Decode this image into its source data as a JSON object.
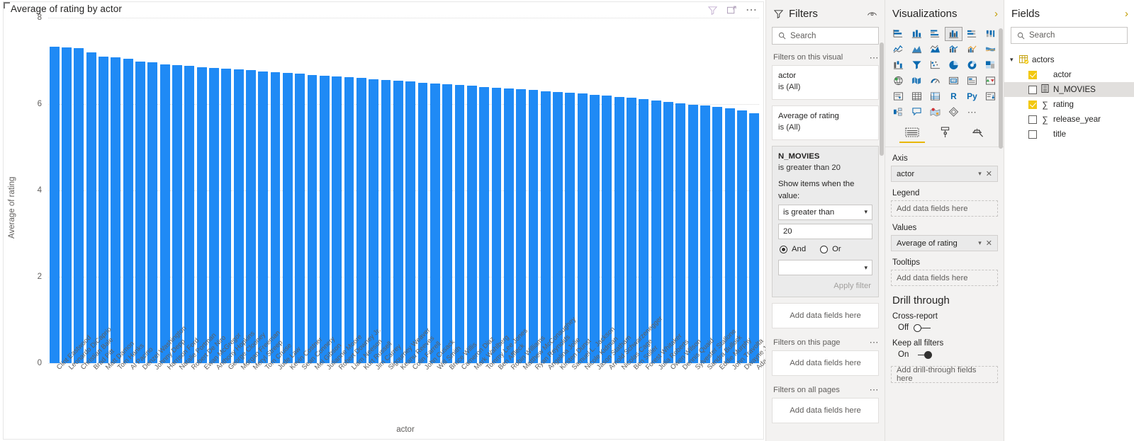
{
  "visual": {
    "title": "Average of rating by actor",
    "x_axis_title": "actor",
    "y_axis_title": "Average of rating",
    "header_icons": [
      "filter-icon",
      "focus-mode-icon",
      "more-options-icon"
    ]
  },
  "chart_data": {
    "type": "bar",
    "title": "Average of rating by actor",
    "xlabel": "actor",
    "ylabel": "Average of rating",
    "ylim": [
      0,
      8
    ],
    "yticks": [
      0,
      2,
      4,
      6,
      8
    ],
    "grid": true,
    "legend": "none",
    "bar_color": "#1f8af5",
    "categories": [
      "Clint Eastwood",
      "Leonardo DiCaprio",
      "Christian Bale",
      "Brad Pitt",
      "Matt Damon",
      "Tom Hanks",
      "Al Pacino",
      "Denzel Washington",
      "Johnny Depp",
      "Harrison Ford",
      "Natalie Portman",
      "Robert De Niro",
      "Ewan McGregor",
      "Anthony Hopkins",
      "George Clooney",
      "Morgan Freeman",
      "Meryl Streep",
      "Tom Cruise",
      "Jude Law",
      "Kevin Costner",
      "Sean Connery",
      "Mel Gibson",
      "Julianne Moore",
      "Robert Downey Jr.",
      "Liam Neeson",
      "Kurt Russell",
      "Jim Carrey",
      "Sigourney Weaver",
      "Keanu Reeves",
      "Colin Farrell",
      "John Cusack",
      "Will Smith",
      "Bruce Willis",
      "Cameron Diaz",
      "Mark Wahlberg",
      "Tommy Lee Jones",
      "Ben Affleck",
      "Robin Williams",
      "Matthew McConaughey",
      "Ryan Reynolds",
      "Angelina Jolie",
      "Kirsten Dunst",
      "Samuel L. Jackson",
      "Nicole Kidman",
      "Jason Statham",
      "Arnold Schwarzenegger",
      "Nicolas Cage",
      "Ben Stiller",
      "Forest Whitaker",
      "Julia Roberts",
      "Owen Wilson",
      "Dennis Quaid",
      "Sylvester Stallone",
      "Sandra Bullock",
      "Eddie Murphy",
      "John Travolta",
      "Dwayne Johnson",
      "Adam Sandler"
    ],
    "values": [
      7.33,
      7.31,
      7.29,
      7.2,
      7.1,
      7.09,
      7.05,
      6.99,
      6.97,
      6.92,
      6.9,
      6.88,
      6.86,
      6.84,
      6.82,
      6.8,
      6.78,
      6.76,
      6.74,
      6.72,
      6.7,
      6.68,
      6.66,
      6.64,
      6.62,
      6.6,
      6.58,
      6.56,
      6.54,
      6.52,
      6.5,
      6.48,
      6.46,
      6.44,
      6.42,
      6.4,
      6.38,
      6.36,
      6.34,
      6.32,
      6.3,
      6.28,
      6.26,
      6.24,
      6.22,
      6.2,
      6.17,
      6.14,
      6.11,
      6.08,
      6.05,
      6.02,
      5.99,
      5.96,
      5.93,
      5.9,
      5.86,
      5.78
    ]
  },
  "filters_pane": {
    "title": "Filters",
    "eye_icon": "hide-pane-icon",
    "search_placeholder": "Search",
    "sections": [
      {
        "label": "Filters on this visual"
      },
      {
        "label": "Filters on this page"
      },
      {
        "label": "Filters on all pages"
      }
    ],
    "visual_filters": [
      {
        "name": "actor",
        "value": "is (All)"
      },
      {
        "name": "Average of rating",
        "value": "is (All)"
      }
    ],
    "active_filter": {
      "name": "N_MOVIES",
      "value": "is greater than 20",
      "show_items_label": "Show items when the value:",
      "condition": "is greater than",
      "amount": "20",
      "and_label": "And",
      "or_label": "Or",
      "and_selected": true,
      "second_condition": "",
      "apply_label": "Apply filter"
    },
    "drop_placeholder": "Add data fields here"
  },
  "viz_pane": {
    "title": "Visualizations",
    "expand_icon": "chevron-right-icon",
    "icons": [
      "stacked-bar-chart-icon",
      "stacked-column-chart-icon",
      "clustered-bar-chart-icon",
      "clustered-column-chart-icon",
      "100-stacked-bar-chart-icon",
      "100-stacked-column-chart-icon",
      "line-chart-icon",
      "area-chart-icon",
      "stacked-area-chart-icon",
      "line-stacked-column-chart-icon",
      "line-clustered-column-chart-icon",
      "ribbon-chart-icon",
      "waterfall-chart-icon",
      "funnel-icon",
      "scatter-chart-icon",
      "pie-chart-icon",
      "donut-chart-icon",
      "treemap-icon",
      "map-icon",
      "filled-map-icon",
      "gauge-icon",
      "card-icon",
      "multi-row-card-icon",
      "kpi-icon",
      "slicer-icon",
      "table-icon",
      "matrix-icon",
      "r-script-visual-icon",
      "python-visual-icon",
      "key-influencers-icon",
      "decomposition-tree-icon",
      "q-and-a-icon",
      "arcgis-maps-icon",
      "paginated-report-icon",
      "more-visuals-icon"
    ],
    "selected_icon_index": 3,
    "tabs": [
      "fields-tab",
      "format-tab",
      "analytics-tab"
    ],
    "active_tab": 0,
    "wells": [
      {
        "label": "Axis",
        "value": "actor",
        "filled": true
      },
      {
        "label": "Legend",
        "value": "Add data fields here",
        "filled": false
      },
      {
        "label": "Values",
        "value": "Average of rating",
        "filled": true
      },
      {
        "label": "Tooltips",
        "value": "Add data fields here",
        "filled": false
      }
    ],
    "drill_through": {
      "title": "Drill through",
      "cross_report_label": "Cross-report",
      "cross_report_state": "Off",
      "keep_filters_label": "Keep all filters",
      "keep_filters_state": "On",
      "drop_placeholder": "Add drill-through fields here"
    }
  },
  "fields_pane": {
    "title": "Fields",
    "expand_icon": "chevron-right-icon",
    "search_placeholder": "Search",
    "table": {
      "name": "actors",
      "expanded": true
    },
    "fields": [
      {
        "name": "actor",
        "checked": true,
        "kind": "text",
        "highlight": false
      },
      {
        "name": "N_MOVIES",
        "checked": false,
        "kind": "measure",
        "highlight": true
      },
      {
        "name": "rating",
        "checked": true,
        "kind": "sum",
        "highlight": false
      },
      {
        "name": "release_year",
        "checked": false,
        "kind": "sum",
        "highlight": false
      },
      {
        "name": "title",
        "checked": false,
        "kind": "text",
        "highlight": false
      }
    ]
  }
}
